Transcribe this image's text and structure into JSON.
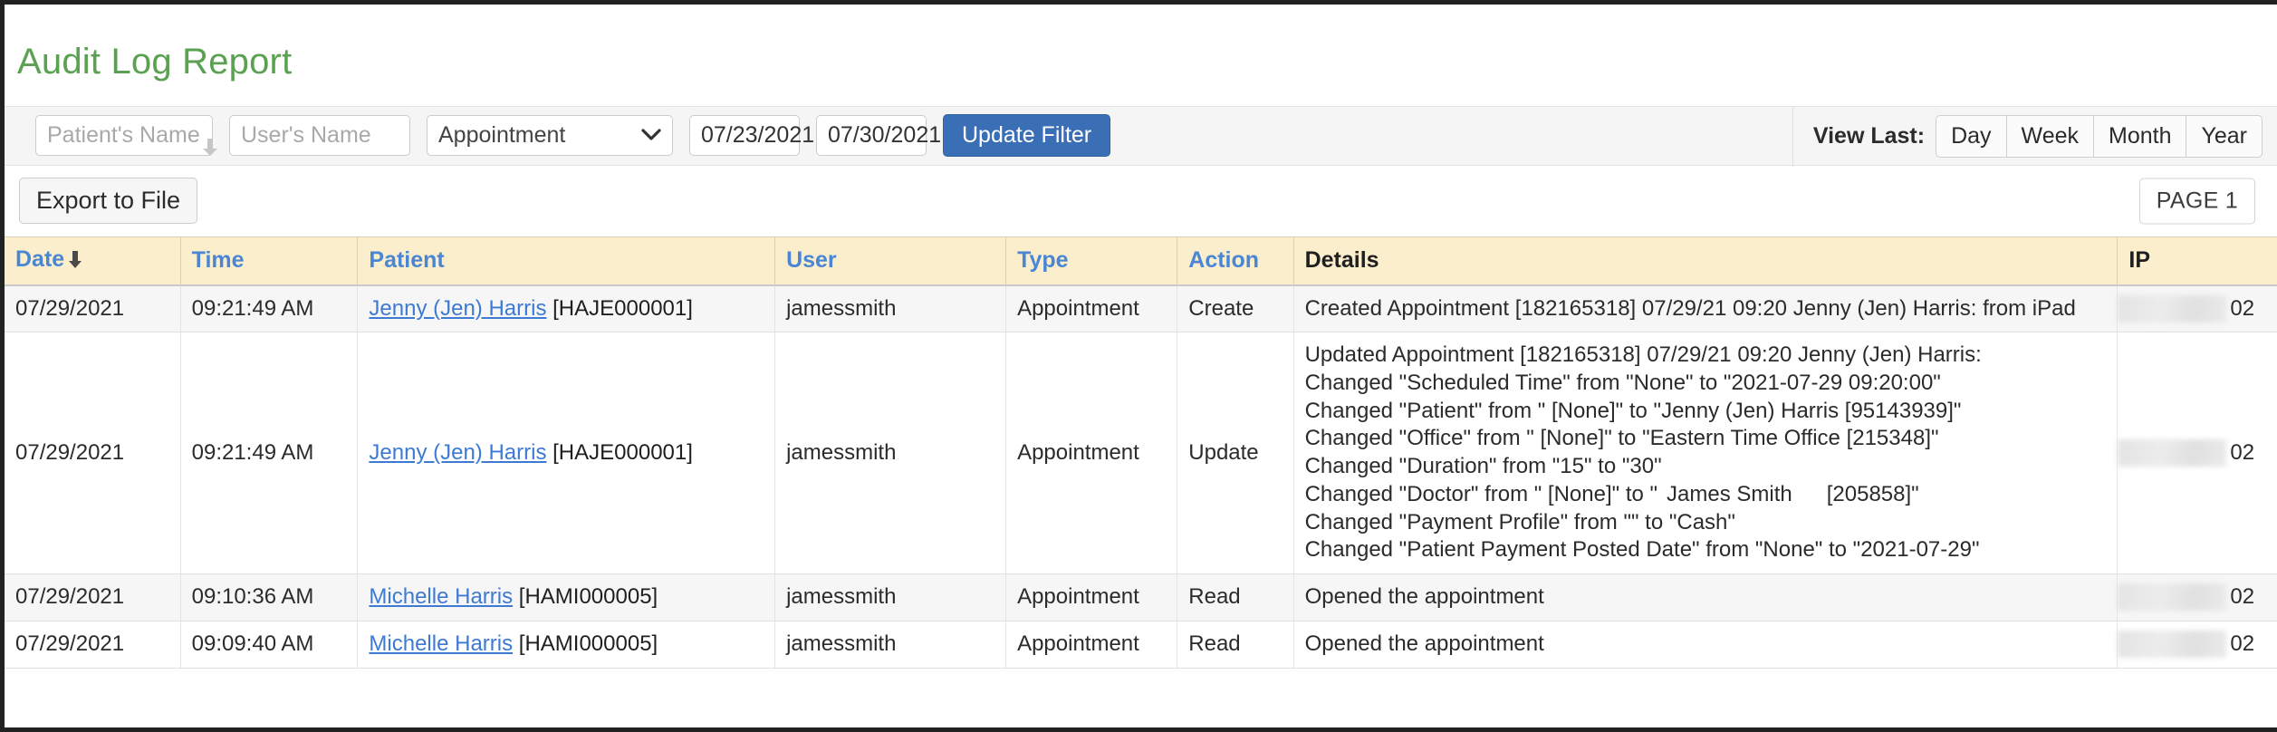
{
  "page": {
    "title": "Audit Log Report",
    "title_color": "#5aa152"
  },
  "filters": {
    "patient_name": {
      "placeholder": "Patient's Name",
      "value": "",
      "icon": "arrow-down-icon"
    },
    "user_name": {
      "placeholder": "User's Name",
      "value": ""
    },
    "type_select": {
      "value": "Appointment",
      "icon": "chevron-down-icon"
    },
    "date_from": {
      "value": "07/23/2021"
    },
    "date_to": {
      "value": "07/30/2021"
    },
    "update_button": {
      "label": "Update Filter",
      "color": "#3a6fb5"
    },
    "view_last": {
      "label": "View Last:",
      "options": [
        "Day",
        "Week",
        "Month",
        "Year"
      ]
    }
  },
  "actions": {
    "export_label": "Export to File",
    "page_label": "PAGE 1"
  },
  "table": {
    "columns": [
      {
        "label": "Date",
        "sortable": true,
        "sort": "desc",
        "sort_icon": "arrow-down-icon"
      },
      {
        "label": "Time",
        "sortable": true
      },
      {
        "label": "Patient",
        "sortable": true
      },
      {
        "label": "User",
        "sortable": true
      },
      {
        "label": "Type",
        "sortable": true
      },
      {
        "label": "Action",
        "sortable": true
      },
      {
        "label": "Details",
        "sortable": false
      },
      {
        "label": "IP",
        "sortable": false
      }
    ],
    "rows": [
      {
        "date": "07/29/2021",
        "time": "09:21:49 AM",
        "patient_link": "Jenny (Jen) Harris",
        "patient_code": "[HAJE000001]",
        "user": "jamessmith",
        "type": "Appointment",
        "action": "Create",
        "details": [
          "Created Appointment [182165318] 07/29/21 09:20 Jenny (Jen) Harris: from iPad"
        ],
        "ip_redacted": true,
        "ip_tail": "02"
      },
      {
        "date": "07/29/2021",
        "time": "09:21:49 AM",
        "patient_link": "Jenny (Jen) Harris",
        "patient_code": "[HAJE000001]",
        "user": "jamessmith",
        "type": "Appointment",
        "action": "Update",
        "details": [
          "Updated Appointment [182165318] 07/29/21 09:20 Jenny (Jen) Harris:",
          "Changed \"Scheduled Time\" from \"None\" to \"2021-07-29 09:20:00\"",
          "Changed \"Patient\" from \" [None]\" to \"Jenny (Jen) Harris [95143939]\"",
          "Changed \"Office\" from \" [None]\" to \"Eastern Time Office [215348]\"",
          "Changed \"Duration\" from \"15\" to \"30\"",
          "Changed \"Payment Profile\" from \"\" to \"Cash\"",
          "Changed \"Patient Payment Posted Date\" from \"None\" to \"2021-07-29\""
        ],
        "doctor_line": {
          "prefix": "Changed \"Doctor\" from \" [None]\" to \"",
          "name": "James Smith",
          "suffix": "[205858]\""
        },
        "ip_redacted": true,
        "ip_tail": "02"
      },
      {
        "date": "07/29/2021",
        "time": "09:10:36 AM",
        "patient_link": "Michelle Harris",
        "patient_code": "[HAMI000005]",
        "user": "jamessmith",
        "type": "Appointment",
        "action": "Read",
        "details": [
          "Opened the appointment"
        ],
        "ip_redacted": true,
        "ip_tail": "02"
      },
      {
        "date": "07/29/2021",
        "time": "09:09:40 AM",
        "patient_link": "Michelle Harris",
        "patient_code": "[HAMI000005]",
        "user": "jamessmith",
        "type": "Appointment",
        "action": "Read",
        "details": [
          "Opened the appointment"
        ],
        "ip_redacted": true,
        "ip_tail": "02"
      }
    ]
  }
}
